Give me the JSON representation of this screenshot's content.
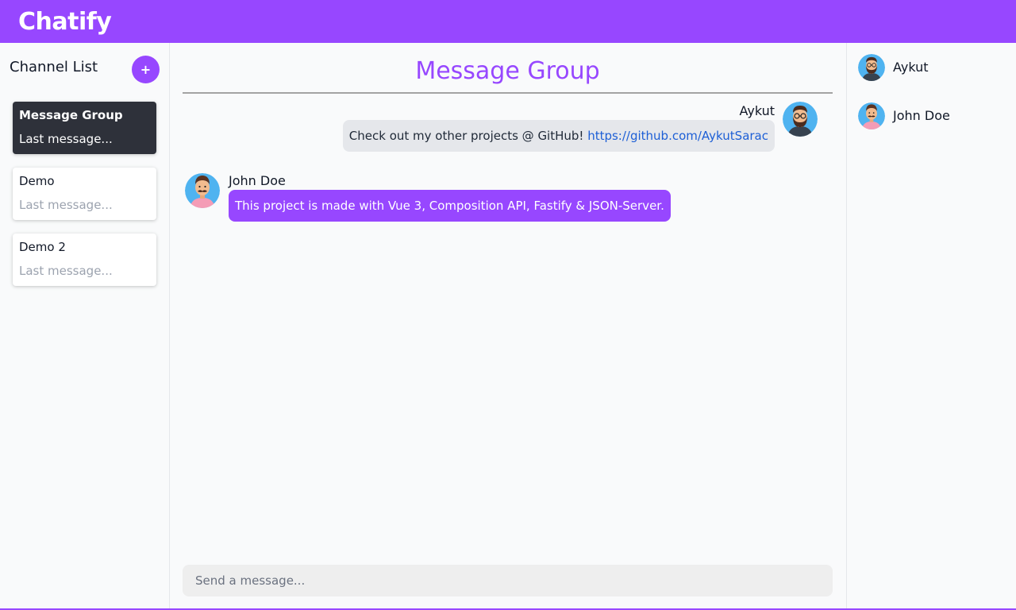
{
  "app": {
    "brand": "Chatify",
    "accent_color": "#9747ff"
  },
  "sidebar": {
    "title": "Channel List",
    "add_button_label": "+",
    "channels": [
      {
        "name": "Message Group",
        "last_message": "Last message...",
        "active": true
      },
      {
        "name": "Demo",
        "last_message": "Last message...",
        "active": false
      },
      {
        "name": "Demo 2",
        "last_message": "Last message...",
        "active": false
      }
    ]
  },
  "chat": {
    "room_title": "Message Group",
    "messages": [
      {
        "sender": "Aykut",
        "avatar": "bearded-man-avatar",
        "text": "Check out my other projects @ GitHub! ",
        "link": "https://github.com/AykutSarac",
        "own": true
      },
      {
        "sender": "John Doe",
        "avatar": "mustache-man-avatar",
        "text": "This project is made with Vue 3, Composition API, Fastify & JSON-Server.",
        "own": false
      }
    ],
    "composer_placeholder": "Send a message..."
  },
  "members": [
    {
      "name": "Aykut",
      "avatar": "bearded-man-avatar"
    },
    {
      "name": "John Doe",
      "avatar": "mustache-man-avatar"
    }
  ]
}
